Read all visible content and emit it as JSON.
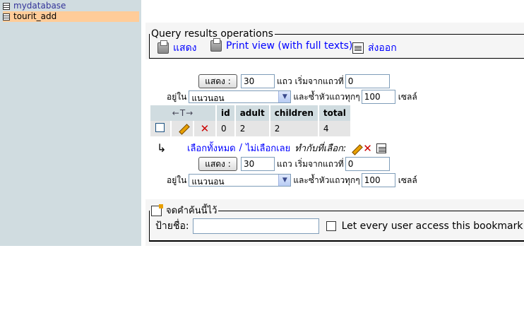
{
  "sidebar": {
    "items": [
      {
        "label": "mydatabase",
        "active": false
      },
      {
        "label": "tourit_add",
        "active": true
      }
    ]
  },
  "query_ops": {
    "legend": "Query results operations",
    "show": "แสดง",
    "print_view": "Print view (with full texts)",
    "export": "ส่งออก"
  },
  "nav_top": {
    "show_button": "แสดง :",
    "rows_value": "30",
    "rows_from_label": "แถว เริ่มจากแถวที่",
    "start_value": "0",
    "in_label": "อยู่ใน",
    "mode_value": "แนวนอน",
    "repeat_label": "และซ้ำหัวแถวทุกๆ",
    "repeat_value": "100",
    "cells_label": "เซลล์"
  },
  "table": {
    "sort_arrows": "←T→",
    "headers": [
      "id",
      "adult",
      "children",
      "total"
    ],
    "rows": [
      [
        "0",
        "2",
        "2",
        "4"
      ]
    ]
  },
  "selection": {
    "check_all": "เลือกทั้งหมด",
    "slash": "/",
    "uncheck_all": "ไม่เลือกเลย",
    "with_selected": "ทำกับที่เลือก:"
  },
  "nav_bottom": {
    "show_button": "แสดง :",
    "rows_value": "30",
    "rows_from_label": "แถว เริ่มจากแถวที่",
    "start_value": "0",
    "in_label": "อยู่ใน",
    "mode_value": "แนวนอน",
    "repeat_label": "และซ้ำหัวแถวทุกๆ",
    "repeat_value": "100",
    "cells_label": "เซลล์"
  },
  "bookmark": {
    "legend": "จดคำค้นนี้ไว้",
    "label_caption": "ป้ายชื่อ:",
    "label_value": "",
    "public_label": "Let every user access this bookmark"
  }
}
